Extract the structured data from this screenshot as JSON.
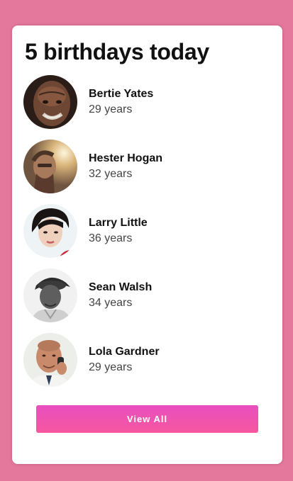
{
  "card": {
    "title": "5 birthdays today"
  },
  "people": [
    {
      "name": "Bertie Yates",
      "age": "29 years"
    },
    {
      "name": "Hester Hogan",
      "age": "32 years"
    },
    {
      "name": "Larry Little",
      "age": "36 years"
    },
    {
      "name": "Sean Walsh",
      "age": "34 years"
    },
    {
      "name": "Lola Gardner",
      "age": "29 years"
    }
  ],
  "actions": {
    "view_all_label": "View All"
  },
  "colors": {
    "page_background": "#e4779c",
    "card_background": "#ffffff",
    "button_gradient_start": "#e84fc0",
    "button_gradient_end": "#f6579e"
  }
}
